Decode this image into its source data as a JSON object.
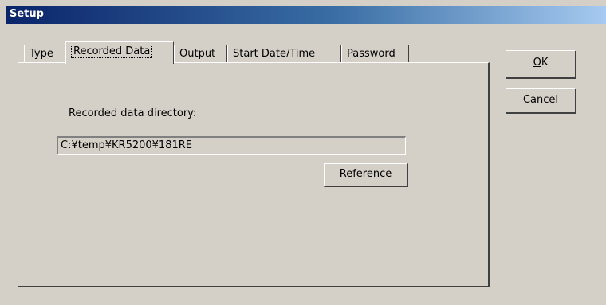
{
  "window": {
    "title": "Setup"
  },
  "tabs": [
    {
      "label": "Type"
    },
    {
      "label": "Recorded Data",
      "active": true
    },
    {
      "label": "Output"
    },
    {
      "label": "Start Date/Time"
    },
    {
      "label": "Password"
    }
  ],
  "recorded": {
    "directory_label": "Recorded data directory:",
    "directory_value": "C:¥temp¥KR5200¥181RE",
    "reference_button": "Reference"
  },
  "buttons": {
    "ok_mnemonic": "O",
    "ok_rest": "K",
    "cancel_mnemonic": "C",
    "cancel_rest": "ancel"
  }
}
